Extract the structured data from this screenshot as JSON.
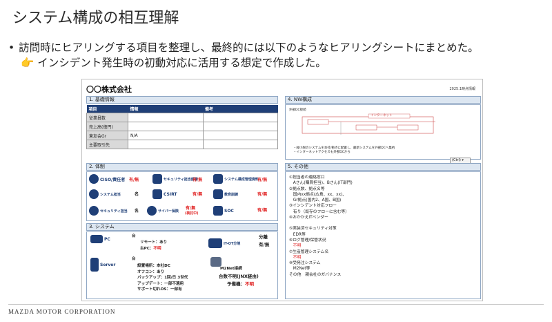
{
  "slide": {
    "title": "システム構成の相互理解",
    "bullet1": "訪問時にヒアリングする項目を整理し、最終的には以下のようなヒアリングシートにまとめた。",
    "bullet2_icon": "👉",
    "bullet2": "インシデント発生時の初動対応に活用する想定で作成した。",
    "footer": "MAZDA MOTOR CORPORATION"
  },
  "sheet": {
    "company": "〇〇株式会社",
    "date": "2025.1時点情報",
    "sec1": "1. 基礎情報",
    "sec2": "2. 体制",
    "sec3": "3. システム",
    "sec4": "4. NW構成",
    "sec5": "5. その他",
    "basic": {
      "headers": [
        "項目",
        "情報",
        "備考"
      ],
      "rows": [
        [
          "従業員数",
          "",
          ""
        ],
        [
          "売上高(億円)",
          "",
          ""
        ],
        [
          "東友会Gr",
          "N/A",
          ""
        ],
        [
          "主要取引先",
          "",
          ""
        ]
      ]
    },
    "org": {
      "ciso_label": "CISO/責任者",
      "yesno": "有/無",
      "security_dept": "セキュリティ担当部署",
      "system_dept": "システム構成管理資料",
      "sys_staff": "システム担当",
      "mei": "名",
      "csirt": "CSIRT",
      "training": "教育訓練",
      "sec_staff": "セキュリティ担当",
      "cyber_ins": "サイバー保険",
      "under_review": "(検討中)",
      "soc": "SOC"
    },
    "system": {
      "pc": "PC",
      "dai": "台",
      "remote": "リモート：あり",
      "old_pc_label": "古PC：",
      "old_pc_value": "不明",
      "server": "Server",
      "server_lines": [
        "設置場所：本社DC",
        "オフコン：あり",
        "バックアップ：1回/日 3世代",
        "アップデート：一部不適用",
        "サポート切れOS：一部有"
      ],
      "itot": "IT-OT分境",
      "bunri": "分離",
      "m2net": "M2Net接続",
      "m2net_count": "台数不明(JNX経由)",
      "spare_label": "予備機：",
      "spare_value": "不明"
    },
    "nw": {
      "dc_label": "外部DC接続",
      "internet": "インターネット",
      "notes": [
        "・緑小限のシステムを本社/拠点に配置し、最新システムを外部DCへ集約",
        "・インターネットアクセスも外部DCから"
      ]
    },
    "ctrl": "(Ctrl) ▾",
    "other": [
      {
        "t": "①担当者の連絡窓口",
        "c": "n"
      },
      {
        "t": "　Aさん(購買担当)、Bさん(IT部門)",
        "c": "n"
      },
      {
        "t": "②拠点数、拠点名等",
        "c": "n"
      },
      {
        "t": "　国内xx拠点(広島、xx、xx)、",
        "c": "n"
      },
      {
        "t": "　Gr拠点(国内2、A国、B国)",
        "c": "n"
      },
      {
        "t": "③インシデント対応フロー",
        "c": "n"
      },
      {
        "t": "　有り（既存のフローに含む等）",
        "c": "n"
      },
      {
        "t": "④おかかえITベンダー",
        "c": "n"
      },
      {
        "t": "",
        "c": "n"
      },
      {
        "t": "⑤実装済セキュリティ対策",
        "c": "n"
      },
      {
        "t": "　EDR等",
        "c": "n"
      },
      {
        "t": "⑥ログ管理/保管状況",
        "c": "n"
      },
      {
        "t": "　不明",
        "c": "r"
      },
      {
        "t": "⑦生産管理システム名",
        "c": "n"
      },
      {
        "t": "　不明",
        "c": "r"
      },
      {
        "t": "⑧受発注システム",
        "c": "n"
      },
      {
        "t": "　M2Net等",
        "c": "n"
      },
      {
        "t": "その他　親会社のガバナンス",
        "c": "n"
      }
    ]
  }
}
